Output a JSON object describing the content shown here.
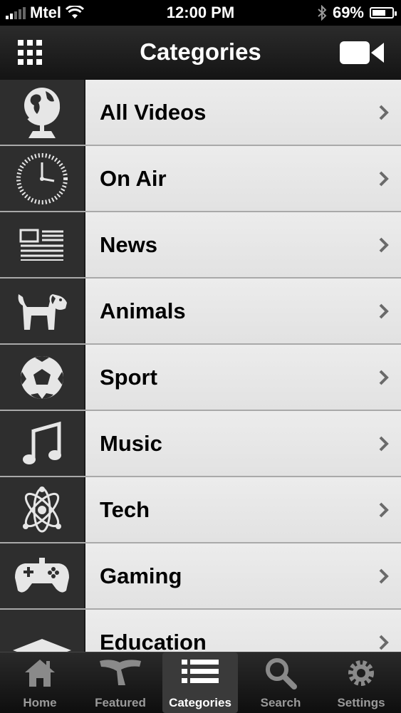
{
  "status_bar": {
    "carrier": "Mtel",
    "time": "12:00 PM",
    "battery": "69%",
    "battery_level": 0.69
  },
  "nav": {
    "title": "Categories",
    "left_icon": "grid-menu-icon",
    "right_icon": "video-camera-icon"
  },
  "categories": [
    {
      "label": "All Videos",
      "icon": "globe-icon"
    },
    {
      "label": "On Air",
      "icon": "clock-icon"
    },
    {
      "label": "News",
      "icon": "newspaper-icon"
    },
    {
      "label": "Animals",
      "icon": "dog-icon"
    },
    {
      "label": "Sport",
      "icon": "soccer-ball-icon"
    },
    {
      "label": "Music",
      "icon": "music-note-icon"
    },
    {
      "label": "Tech",
      "icon": "atom-icon"
    },
    {
      "label": "Gaming",
      "icon": "gamepad-icon"
    },
    {
      "label": "Education",
      "icon": "graduation-cap-icon"
    }
  ],
  "tabs": [
    {
      "label": "Home",
      "icon": "home-icon"
    },
    {
      "label": "Featured",
      "icon": "featured-icon"
    },
    {
      "label": "Categories",
      "icon": "list-icon",
      "active": true
    },
    {
      "label": "Search",
      "icon": "search-icon"
    },
    {
      "label": "Settings",
      "icon": "gear-icon"
    }
  ],
  "colors": {
    "icon_cell_bg": "#2e2e2e",
    "row_bg": "#e6e6e6",
    "active_tab_bg": "#3a3a3a"
  }
}
